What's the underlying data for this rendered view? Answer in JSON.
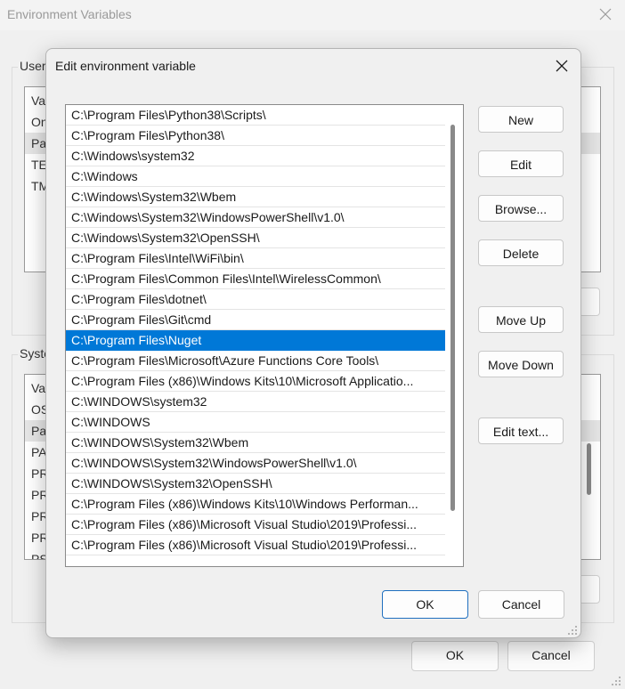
{
  "background": {
    "title": "Environment Variables",
    "user_group_label": "User",
    "system_group_label": "System",
    "user_rows": [
      "Va",
      "On",
      "Pa",
      "TE",
      "TM"
    ],
    "system_rows": [
      "Va",
      "OS",
      "Pa",
      "PA",
      "PR",
      "PR",
      "PR",
      "PR",
      "PS"
    ],
    "ok_label": "OK",
    "cancel_label": "Cancel"
  },
  "dialog": {
    "title": "Edit environment variable",
    "paths": [
      "C:\\Program Files\\Python38\\Scripts\\",
      "C:\\Program Files\\Python38\\",
      "C:\\Windows\\system32",
      "C:\\Windows",
      "C:\\Windows\\System32\\Wbem",
      "C:\\Windows\\System32\\WindowsPowerShell\\v1.0\\",
      "C:\\Windows\\System32\\OpenSSH\\",
      "C:\\Program Files\\Intel\\WiFi\\bin\\",
      "C:\\Program Files\\Common Files\\Intel\\WirelessCommon\\",
      "C:\\Program Files\\dotnet\\",
      "C:\\Program Files\\Git\\cmd",
      "C:\\Program Files\\Nuget",
      "C:\\Program Files\\Microsoft\\Azure Functions Core Tools\\",
      "C:\\Program Files (x86)\\Windows Kits\\10\\Microsoft Applicatio...",
      "C:\\WINDOWS\\system32",
      "C:\\WINDOWS",
      "C:\\WINDOWS\\System32\\Wbem",
      "C:\\WINDOWS\\System32\\WindowsPowerShell\\v1.0\\",
      "C:\\WINDOWS\\System32\\OpenSSH\\",
      "C:\\Program Files (x86)\\Windows Kits\\10\\Windows Performan...",
      "C:\\Program Files (x86)\\Microsoft Visual Studio\\2019\\Professi...",
      "C:\\Program Files (x86)\\Microsoft Visual Studio\\2019\\Professi..."
    ],
    "selected_path": "C:\\Program Files\\Nuget",
    "buttons": {
      "new": "New",
      "edit": "Edit",
      "browse": "Browse...",
      "delete": "Delete",
      "move_up": "Move Up",
      "move_down": "Move Down",
      "edit_text": "Edit text..."
    },
    "ok_label": "OK",
    "cancel_label": "Cancel"
  },
  "colors": {
    "selection": "#0078d7",
    "default_button_border": "#1f6fbf"
  },
  "icons": {
    "close": "close-icon",
    "resize_grip": "resize-grip-icon"
  }
}
